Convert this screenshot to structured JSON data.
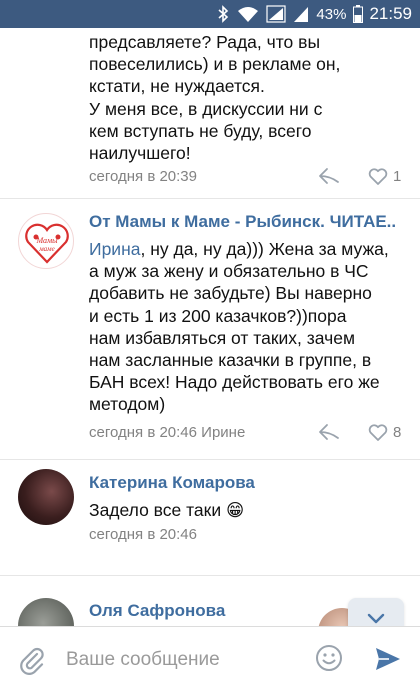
{
  "statusbar": {
    "battery": "43%",
    "time": "21:59",
    "icons": [
      "bluetooth-icon",
      "wifi-icon",
      "signal-icon",
      "signal-icon-2",
      "battery-icon"
    ]
  },
  "comments": [
    {
      "lines": [
        "предсавляете? Рада, что вы",
        "повеселились) и в рекламе он,",
        "кстати, не нуждается.",
        "У меня все, в дискуссии ни с",
        "кем вступать не буду, всего",
        "наилучшего!"
      ],
      "meta": "сегодня в 20:39",
      "likes": "1"
    },
    {
      "author": "От Мамы к Маме - Рыбинск. ЧИТАЕ..",
      "addressee": "Ирина",
      "lines_first_rest": ", ну да, ну да))) Жена за мужа,",
      "lines": [
        "а муж за жену и обязательно в ЧС",
        "добавить не забудьте) Вы наверно",
        "и есть 1 из 200 казачков?))пора",
        "нам избавляться от таких, зачем",
        "нам засланные казачки в группе, в",
        "БАН всех! Надо действовать его же",
        "методом)"
      ],
      "meta": "сегодня в 20:46 Ирине",
      "likes": "8",
      "logo_text": [
        "Мамы",
        "мамe"
      ]
    },
    {
      "author": "Катерина Комарова",
      "text": "Задело все таки",
      "emoji": "😁",
      "meta": "сегодня в 20:46"
    },
    {
      "author": "Оля Сафронова"
    }
  ],
  "composer": {
    "placeholder": "Ваше сообщение"
  },
  "colors": {
    "statusbar": "#3d5a80",
    "author": "#3f6d9f",
    "meta": "#828282",
    "send": "#4a76a8"
  }
}
